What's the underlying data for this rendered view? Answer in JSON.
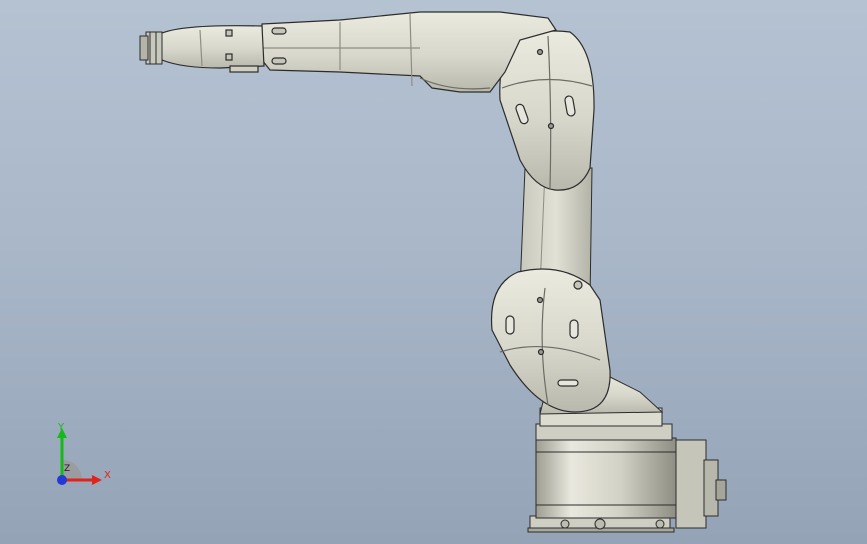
{
  "viewport": {
    "background_top": "#b4c2d2",
    "background_bottom": "#94a3b6"
  },
  "model": {
    "body_color": "#d9d8cc",
    "shade_color": "#b7b6aa",
    "edge_color": "#2c2c2c"
  },
  "triad": {
    "x_label": "X",
    "y_label": "Y",
    "z_label": "Z",
    "x_color": "#e0241a",
    "y_color": "#16b81a",
    "z_color": "#2438d6"
  }
}
